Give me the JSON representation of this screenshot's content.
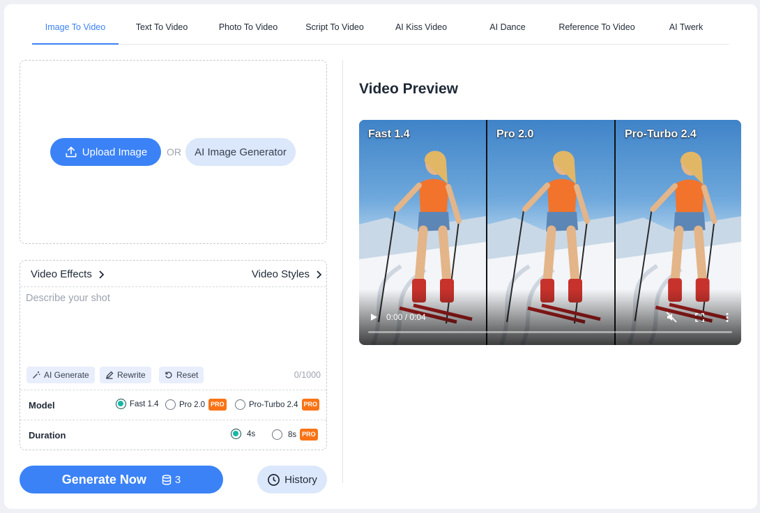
{
  "tabs": [
    {
      "label": "Image To Video",
      "active": true
    },
    {
      "label": "Text To Video",
      "active": false
    },
    {
      "label": "Photo To Video",
      "active": false
    },
    {
      "label": "Script To Video",
      "active": false
    },
    {
      "label": "AI Kiss Video",
      "active": false
    },
    {
      "label": "AI Dance",
      "active": false
    },
    {
      "label": "Reference To Video",
      "active": false
    },
    {
      "label": "AI Twerk",
      "active": false
    }
  ],
  "upload": {
    "upload_label": "Upload Image",
    "or_label": "OR",
    "ai_generator_label": "AI Image Generator"
  },
  "prompt": {
    "effects_label": "Video Effects",
    "styles_label": "Video Styles",
    "placeholder": "Describe your shot",
    "value": "",
    "ai_generate_label": "AI Generate",
    "rewrite_label": "Rewrite",
    "reset_label": "Reset",
    "counter": "0/1000"
  },
  "model": {
    "label": "Model",
    "options": [
      {
        "label": "Fast 1.4",
        "checked": true,
        "pro": false
      },
      {
        "label": "Pro 2.0",
        "checked": false,
        "pro": true
      },
      {
        "label": "Pro-Turbo 2.4",
        "checked": false,
        "pro": true
      }
    ]
  },
  "duration": {
    "label": "Duration",
    "options": [
      {
        "label": "4s",
        "checked": true,
        "pro": false
      },
      {
        "label": "8s",
        "checked": false,
        "pro": true
      }
    ]
  },
  "pro_badge": "PRO",
  "generate": {
    "label": "Generate Now",
    "credits": "3"
  },
  "history": {
    "label": "History"
  },
  "preview": {
    "title": "Video Preview",
    "panels": [
      "Fast 1.4",
      "Pro 2.0",
      "Pro-Turbo 2.4"
    ],
    "time": "0:00 / 0:04",
    "progress": 0
  },
  "colors": {
    "accent": "#3b82f6",
    "accent_light": "#dbe7fb",
    "pro": "#f97316",
    "radio_checked": "#14b8a6"
  }
}
